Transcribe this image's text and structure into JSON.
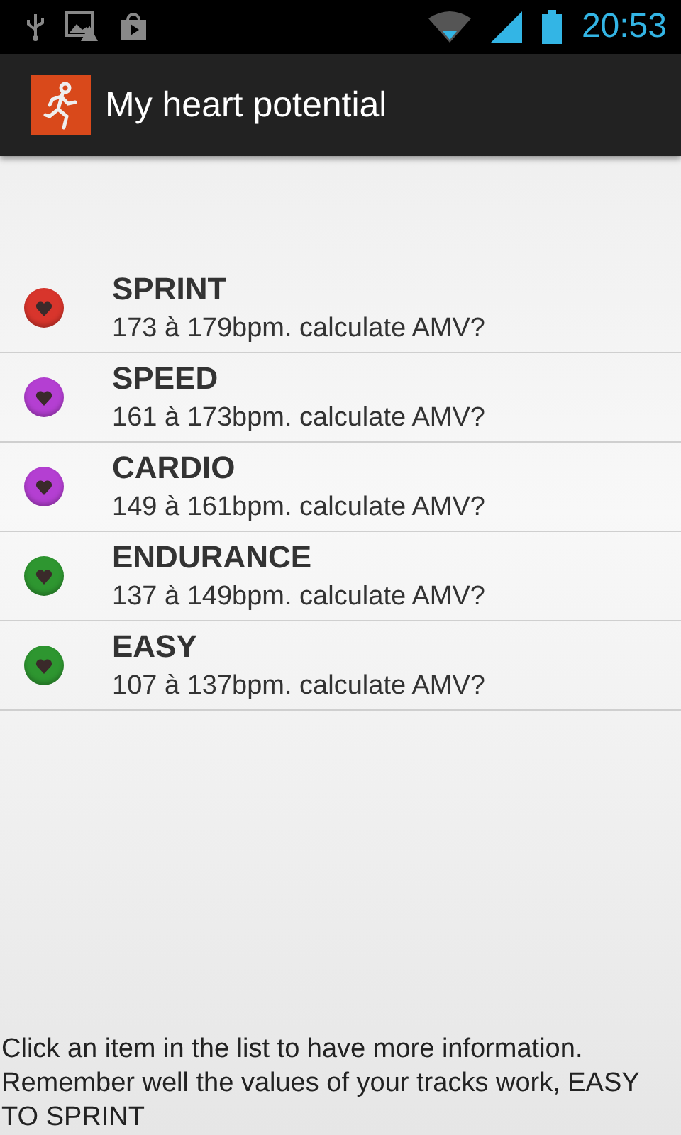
{
  "status_bar": {
    "time": "20:53"
  },
  "app_bar": {
    "title": "My heart potential"
  },
  "zones": [
    {
      "name": "SPRINT",
      "range": "173 à 179bpm. calculate AMV?",
      "color": "#d8352c"
    },
    {
      "name": "SPEED",
      "range": "161 à 173bpm. calculate AMV?",
      "color": "#b43fd2"
    },
    {
      "name": "CARDIO",
      "range": "149 à 161bpm. calculate AMV?",
      "color": "#b43fd2"
    },
    {
      "name": "ENDURANCE",
      "range": "137 à 149bpm. calculate AMV?",
      "color": "#2e9630"
    },
    {
      "name": "EASY",
      "range": "107 à 137bpm. calculate AMV?",
      "color": "#2e9630"
    }
  ],
  "footer": "Click an item in the list to have more information. Remember well the values of your tracks work, EASY TO SPRINT"
}
